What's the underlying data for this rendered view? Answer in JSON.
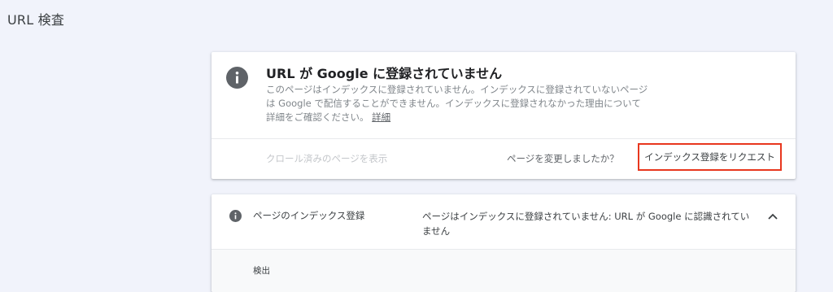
{
  "page": {
    "title": "URL 検査"
  },
  "status_card": {
    "icon": "info-icon",
    "title": "URL が Google に登録されていません",
    "description": "このページはインデックスに登録されていません。インデックスに登録されていないページは Google で配信することができません。インデックスに登録されなかった理由について詳細をご確認ください。",
    "details_link": "詳細",
    "crawled_link": "クロール済みのページを表示",
    "changed_question": "ページを変更しましたか？",
    "request_button": "インデックス登録をリクエスト",
    "colors": {
      "highlight_border": "#e8371e",
      "icon": "#5f6368"
    }
  },
  "coverage_card": {
    "icon": "info-icon",
    "label": "ページのインデックス登録",
    "value": "ページはインデックスに登録されていません: URL が Google に認識されていません",
    "toggle_icon": "chevron-up-icon",
    "detect_label": "検出"
  }
}
